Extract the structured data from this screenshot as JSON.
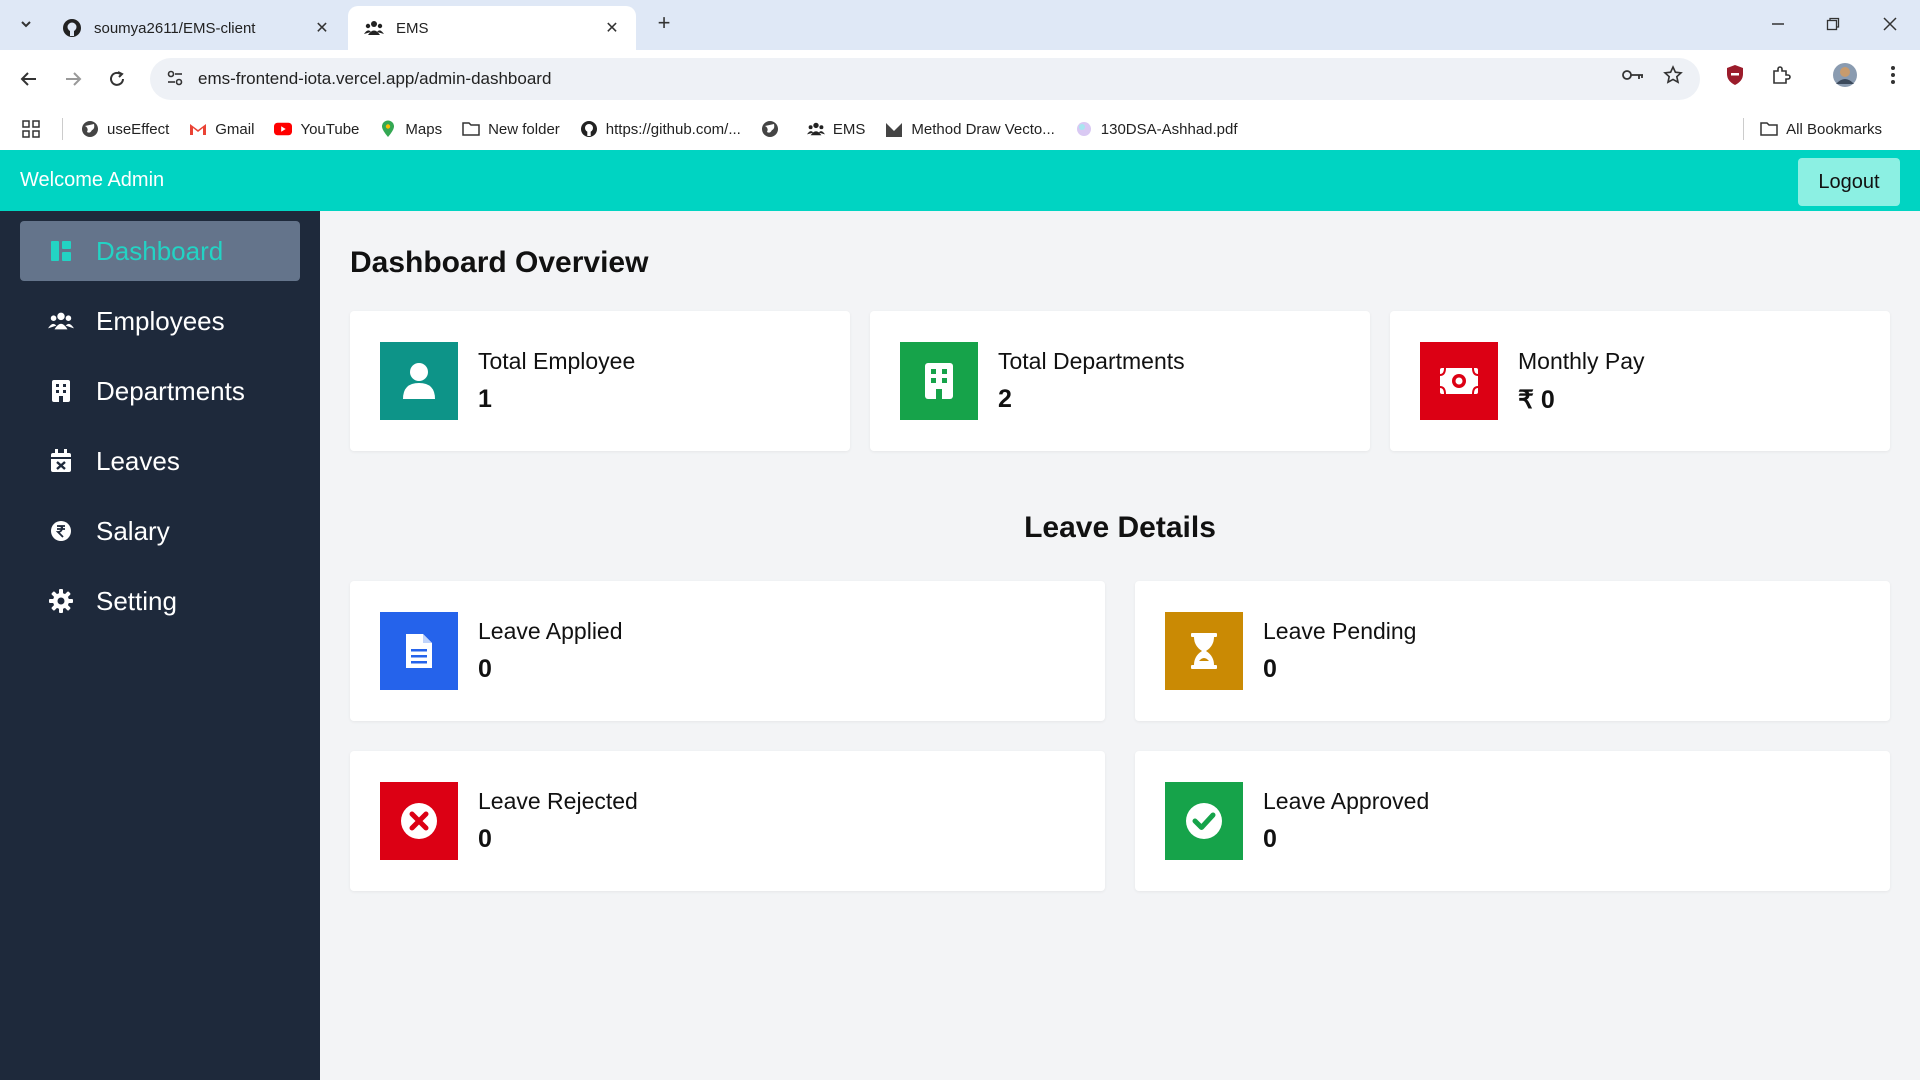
{
  "browser": {
    "tabs": [
      {
        "title": "soumya2611/EMS-client",
        "icon": "github-icon"
      },
      {
        "title": "EMS",
        "icon": "users-icon",
        "active": true
      }
    ],
    "url": "ems-frontend-iota.vercel.app/admin-dashboard",
    "bookmarks": [
      {
        "label": "useEffect",
        "icon": "globe-icon"
      },
      {
        "label": "Gmail",
        "icon": "gmail-icon"
      },
      {
        "label": "YouTube",
        "icon": "youtube-icon"
      },
      {
        "label": "Maps",
        "icon": "maps-icon"
      },
      {
        "label": "New folder",
        "icon": "folder-icon"
      },
      {
        "label": "https://github.com/...",
        "icon": "github-icon"
      },
      {
        "label": "",
        "icon": "globe-icon"
      },
      {
        "label": "EMS",
        "icon": "users-icon"
      },
      {
        "label": "Method Draw Vecto...",
        "icon": "method-draw-icon"
      },
      {
        "label": "130DSA-Ashhad.pdf",
        "icon": "pdf-icon"
      }
    ],
    "all_bookmarks": "All Bookmarks"
  },
  "header": {
    "welcome": "Welcome Admin",
    "logout_label": "Logout"
  },
  "sidebar": {
    "items": [
      {
        "label": "Dashboard",
        "icon": "dashboard-icon",
        "active": true
      },
      {
        "label": "Employees",
        "icon": "users-icon"
      },
      {
        "label": "Departments",
        "icon": "building-icon"
      },
      {
        "label": "Leaves",
        "icon": "calendar-x-icon"
      },
      {
        "label": "Salary",
        "icon": "rupee-icon"
      },
      {
        "label": "Setting",
        "icon": "gear-icon"
      }
    ]
  },
  "main": {
    "title": "Dashboard Overview",
    "summary_cards": [
      {
        "label": "Total Employee",
        "value": "1",
        "icon": "user-icon",
        "color": "#0d9488"
      },
      {
        "label": "Total Departments",
        "value": "2",
        "icon": "building-icon",
        "color": "#16a34a"
      },
      {
        "label": "Monthly Pay",
        "value": "₹ 0",
        "icon": "money-icon",
        "color": "#dc0014"
      }
    ],
    "leave_title": "Leave Details",
    "leave_cards": [
      {
        "label": "Leave Applied",
        "value": "0",
        "icon": "file-icon",
        "color": "#2563eb"
      },
      {
        "label": "Leave Pending",
        "value": "0",
        "icon": "hourglass-icon",
        "color": "#ca8a04"
      },
      {
        "label": "Leave Rejected",
        "value": "0",
        "icon": "x-circle-icon",
        "color": "#dc0014"
      },
      {
        "label": "Leave Approved",
        "value": "0",
        "icon": "check-circle-icon",
        "color": "#16a34a"
      }
    ]
  },
  "colors": {
    "accent": "#00d4c2",
    "sidebar_bg": "#1e293b",
    "active_item_bg": "#64748b"
  }
}
